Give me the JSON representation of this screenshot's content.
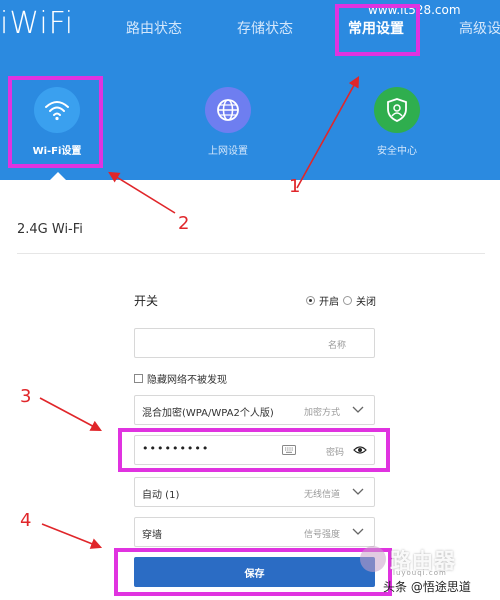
{
  "header": {
    "logo": "iWiFi",
    "watermark_url": "www.it528.com",
    "nav": [
      {
        "label": "路由状态"
      },
      {
        "label": "存储状态"
      },
      {
        "label": "常用设置"
      },
      {
        "label": "高级设"
      }
    ],
    "features": [
      {
        "label": "Wi-Fi设置",
        "icon": "wifi-icon",
        "color": "#3aa0ef"
      },
      {
        "label": "上网设置",
        "icon": "globe-icon",
        "color": "#6e7ef0"
      },
      {
        "label": "安全中心",
        "icon": "shield-user-icon",
        "color": "#2fae4e"
      }
    ]
  },
  "section": {
    "title": "2.4G Wi-Fi"
  },
  "form": {
    "switch_label": "开关",
    "switch_on": "开启",
    "switch_off": "关闭",
    "name_placeholder": "名称",
    "hide_network": "隐藏网络不被发现",
    "encryption_value": "混合加密(WPA/WPA2个人版)",
    "encryption_label": "加密方式",
    "password_value": "•••••••••",
    "password_label": "密码",
    "channel_value": "自动 (1)",
    "channel_label": "无线信道",
    "signal_value": "穿墙",
    "signal_label": "信号强度",
    "save_label": "保存"
  },
  "annotations": {
    "step1": "1",
    "step2": "2",
    "step3": "3",
    "step4": "4",
    "highlight_color": "#e033e0",
    "arrow_color": "#e0262a"
  },
  "watermark": {
    "brand": "路由器",
    "brand_sub": "luyouqi.com",
    "credit": "头条 @悟途思道"
  }
}
